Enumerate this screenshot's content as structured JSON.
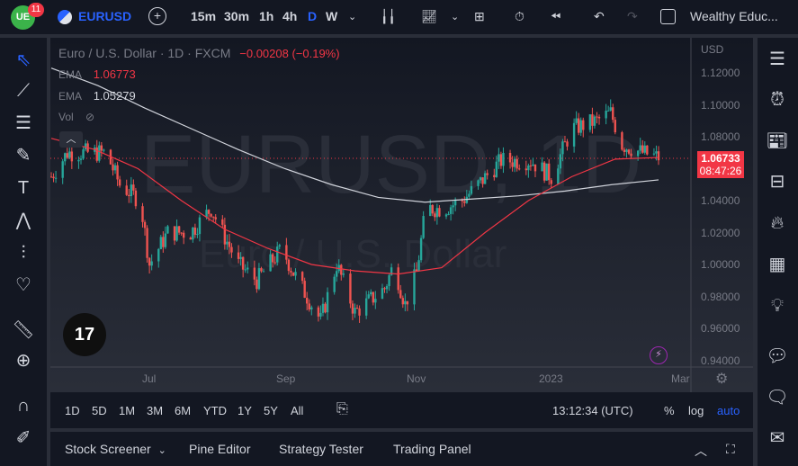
{
  "header": {
    "notifications": "11",
    "symbol": "EURUSD",
    "intervals": [
      "15m",
      "30m",
      "1h",
      "4h",
      "D",
      "W"
    ],
    "active_interval": "D",
    "account": "Wealthy Educ..."
  },
  "legend": {
    "title": "Euro / U.S. Dollar · 1D · FXCM",
    "change": "−0.00208 (−0.19%)",
    "ema1_label": "EMA",
    "ema1_value": "1.06773",
    "ema2_label": "EMA",
    "ema2_value": "1.05279",
    "vol_label": "Vol"
  },
  "watermark": {
    "symbol": "EURUSD, 1D",
    "name": "Euro / U.S. Dollar"
  },
  "price_axis": {
    "currency": "USD",
    "ticks": [
      "1.12000",
      "1.10000",
      "1.08000",
      "1.06000",
      "1.04000",
      "1.02000",
      "1.00000",
      "0.98000",
      "0.96000",
      "0.94000"
    ],
    "last_price": "1.06733",
    "countdown": "08:47:26"
  },
  "time_axis": {
    "ticks": [
      "Jul",
      "Sep",
      "Nov",
      "2023",
      "Mar"
    ]
  },
  "ranges": [
    "1D",
    "5D",
    "1M",
    "3M",
    "6M",
    "YTD",
    "1Y",
    "5Y",
    "All"
  ],
  "clock": "13:12:34 (UTC)",
  "scale_opts": [
    "%",
    "log",
    "auto"
  ],
  "panels": [
    "Stock Screener",
    "Pine Editor",
    "Strategy Tester",
    "Trading Panel"
  ],
  "colors": {
    "up": "#26a69a",
    "down": "#ef5350",
    "ema_fast": "#f23645",
    "ema_slow": "#d1d4dc",
    "accent": "#2962ff",
    "price_label": "#f23645"
  },
  "chart_data": {
    "type": "candlestick",
    "ylim": [
      0.94,
      1.12
    ],
    "anchors": [
      [
        "2022-06-01",
        1.055
      ],
      [
        "2022-06-08",
        1.07
      ],
      [
        "2022-06-25",
        1.07
      ],
      [
        "2022-07-01",
        1.05
      ],
      [
        "2022-07-10",
        1.04
      ],
      [
        "2022-07-14",
        1.0
      ],
      [
        "2022-07-22",
        1.02
      ],
      [
        "2022-08-01",
        1.02
      ],
      [
        "2022-08-10",
        1.035
      ],
      [
        "2022-08-15",
        1.02
      ],
      [
        "2022-08-22",
        1.0
      ],
      [
        "2022-08-30",
        0.99
      ],
      [
        "2022-09-10",
        1.01
      ],
      [
        "2022-09-15",
        0.995
      ],
      [
        "2022-09-27",
        0.965
      ],
      [
        "2022-10-04",
        1.0
      ],
      [
        "2022-10-12",
        0.97
      ],
      [
        "2022-10-25",
        0.985
      ],
      [
        "2022-10-29",
        1.0
      ],
      [
        "2022-11-03",
        0.975
      ],
      [
        "2022-11-08",
        0.995
      ],
      [
        "2022-11-12",
        1.035
      ],
      [
        "2022-11-20",
        1.035
      ],
      [
        "2022-11-28",
        1.04
      ],
      [
        "2022-12-05",
        1.05
      ],
      [
        "2022-12-15",
        1.065
      ],
      [
        "2022-12-28",
        1.065
      ],
      [
        "2023-01-06",
        1.055
      ],
      [
        "2023-01-15",
        1.085
      ],
      [
        "2023-01-26",
        1.09
      ],
      [
        "2023-02-01",
        1.095
      ],
      [
        "2023-02-06",
        1.075
      ],
      [
        "2023-02-15",
        1.07
      ],
      [
        "2023-02-22",
        1.067
      ]
    ],
    "ema_fast": [
      1.079,
      1.072,
      1.06,
      1.04,
      1.022,
      1.01,
      1.0,
      0.996,
      0.994,
      0.998,
      1.02,
      1.04,
      1.055,
      1.066,
      1.067
    ],
    "ema_slow": [
      1.123,
      1.112,
      1.098,
      1.085,
      1.072,
      1.06,
      1.05,
      1.042,
      1.039,
      1.041,
      1.043,
      1.046,
      1.05,
      1.053
    ]
  }
}
